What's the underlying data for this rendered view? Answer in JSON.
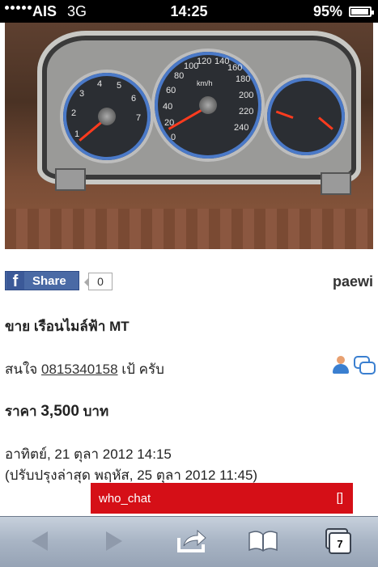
{
  "status_bar": {
    "carrier": "AIS",
    "network": "3G",
    "time": "14:25",
    "battery": "95%"
  },
  "photo": {
    "subject": "instrument-cluster-photo",
    "speedo_labels": [
      "0",
      "20",
      "40",
      "60",
      "80",
      "100",
      "120",
      "140",
      "160",
      "180",
      "200",
      "220",
      "240"
    ],
    "speedo_unit": "km/h",
    "tacho_labels": [
      "1",
      "2",
      "3",
      "4",
      "5",
      "6",
      "7"
    ]
  },
  "post": {
    "share_label": "Share",
    "share_count": "0",
    "username": "paewi",
    "title": "ขาย เรือนไมล์ฟ้า MT",
    "contact_prefix": "สนใจ",
    "contact_phone": "0815340158",
    "contact_suffix": "เป้ ครับ",
    "price_label": "ราคา",
    "price_value": "3,500",
    "price_unit": "บาท",
    "posted": "อาทิตย์, 21 ตุลา 2012 14:15",
    "updated": "(ปรับปรุงล่าสุด พฤหัส, 25 ตุลา 2012 11:45)"
  },
  "chat_widget": {
    "label": "who_chat",
    "toggle": "[]"
  },
  "toolbar": {
    "tab_count": "7",
    "icons": [
      "back-icon",
      "forward-icon",
      "share-icon",
      "bookmarks-icon",
      "tabs-icon"
    ]
  },
  "colors": {
    "facebook": "#4a6aa5",
    "chat_bar": "#d50f17",
    "toolbar": "#a8b4c4"
  }
}
